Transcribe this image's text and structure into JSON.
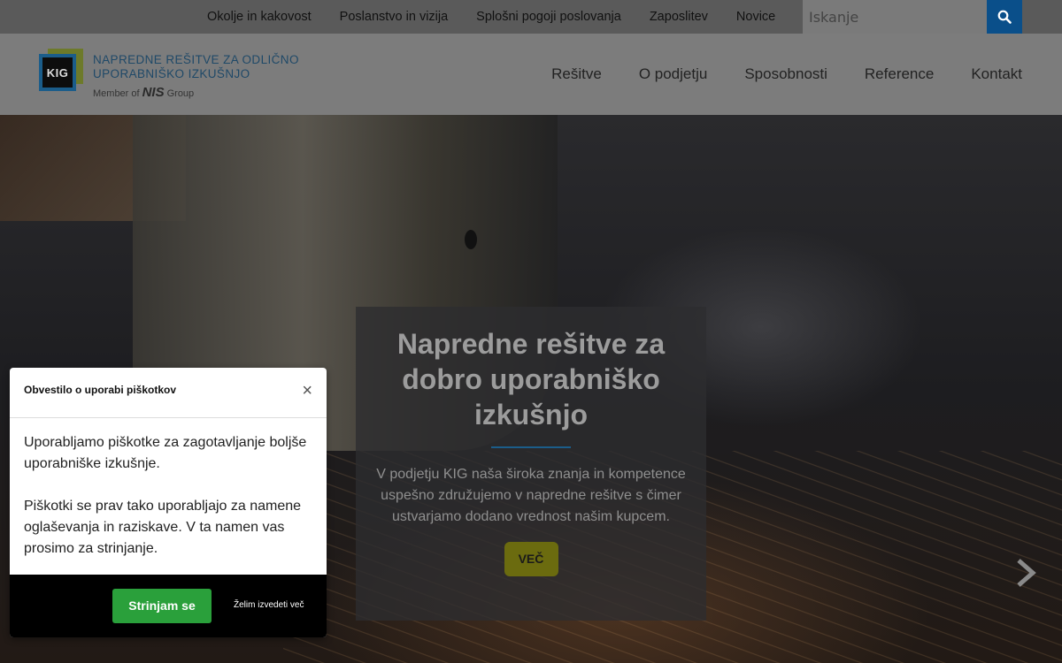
{
  "topnav": {
    "items": [
      "Okolje in kakovost",
      "Poslanstvo in vizija",
      "Splošni pogoji poslovanja",
      "Zaposlitev",
      "Novice"
    ],
    "search_placeholder": "Iskanje"
  },
  "logo": {
    "mark": "KIG",
    "line1": "NAPREDNE REŠITVE ZA ODLIČNO",
    "line2": "UPORABNIŠKO IZKUŠNJO",
    "member_prefix": "Member of",
    "member_brand": "NIS",
    "member_suffix": "Group"
  },
  "mainnav": {
    "items": [
      "Rešitve",
      "O podjetju",
      "Sposobnosti",
      "Reference",
      "Kontakt"
    ]
  },
  "hero": {
    "title": "Napredne rešitve za dobro uporabniško izkušnjo",
    "text": "V podjetju KIG naša široka znanja in kompetence uspešno združujemo v napredne rešitve s čimer ustvarjamo  dodano vrednost našim kupcem.",
    "button": "VEČ"
  },
  "cookie": {
    "title": "Obvestilo o uporabi piškotkov",
    "close": "×",
    "paragraph1": "Uporabljamo piškotke za zagotavljanje boljše uporabniške izkušnje.",
    "paragraph2": "Piškotki se prav tako uporabljajo za namene oglaševanja in raziskave. V ta namen vas prosimo za strinjanje.",
    "accept": "Strinjam se",
    "learn_more": "Želim izvedeti več"
  },
  "colors": {
    "accent_blue": "#0a4f8a",
    "accept_green": "#2aa03b",
    "more_button": "#6b6b0f"
  }
}
